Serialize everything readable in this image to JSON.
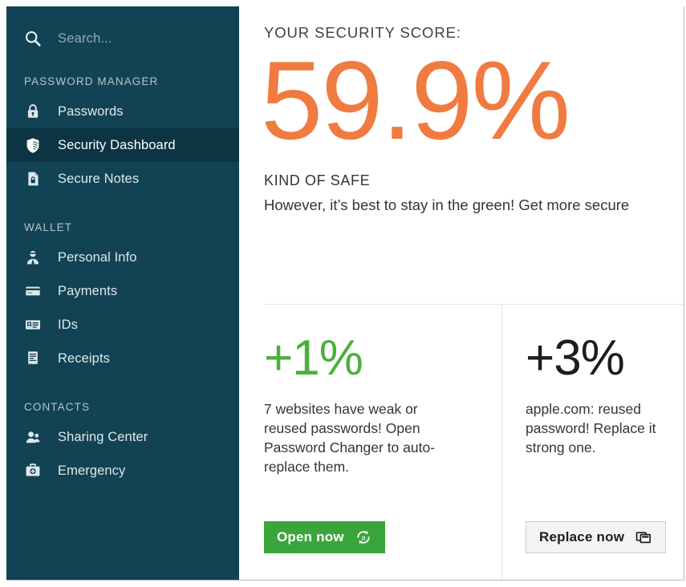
{
  "sidebar": {
    "search": {
      "icon": "search-icon",
      "placeholder": "Search..."
    },
    "groups": [
      {
        "title": "PASSWORD MANAGER",
        "items": [
          {
            "label": "Passwords",
            "icon": "padlock-icon",
            "active": false
          },
          {
            "label": "Security Dashboard",
            "icon": "shield-icon",
            "active": true
          },
          {
            "label": "Secure Notes",
            "icon": "locked-note-icon",
            "active": false
          }
        ]
      },
      {
        "title": "WALLET",
        "items": [
          {
            "label": "Personal Info",
            "icon": "person-icon",
            "active": false
          },
          {
            "label": "Payments",
            "icon": "credit-card-icon",
            "active": false
          },
          {
            "label": "IDs",
            "icon": "id-card-icon",
            "active": false
          },
          {
            "label": "Receipts",
            "icon": "receipt-icon",
            "active": false
          }
        ]
      },
      {
        "title": "CONTACTS",
        "items": [
          {
            "label": "Sharing Center",
            "icon": "two-people-icon",
            "active": false
          },
          {
            "label": "Emergency",
            "icon": "medical-kit-icon",
            "active": false
          }
        ]
      }
    ]
  },
  "main": {
    "score_caption": "YOUR SECURITY SCORE:",
    "score_value": "59.9%",
    "verdict_title": "KIND OF SAFE",
    "verdict_subtitle": "However, it’s best to stay in the green! Get more secure",
    "cards": [
      {
        "delta": "+1%",
        "text": "7 websites have weak or reused passwords! Open Password Changer to auto-replace them.",
        "button_label": "Open now",
        "button_icon": "auto-change-password-icon"
      },
      {
        "delta": "+3%",
        "text": "apple.com: reused password! Replace it\nstrong one.",
        "button_label": "Replace now",
        "button_icon": "copy-window-icon"
      }
    ]
  },
  "colors": {
    "sidebar_bg": "#114354",
    "sidebar_active_bg": "#0c3443",
    "score_orange": "#f07b40",
    "delta_green": "#4cb03c",
    "button_green": "#3aa53a"
  }
}
